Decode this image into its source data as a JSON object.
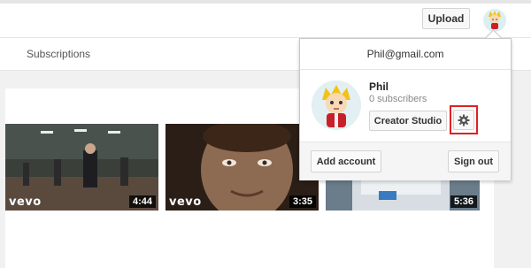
{
  "header": {
    "upload_label": "Upload"
  },
  "subnav": {
    "subscriptions_label": "Subscriptions"
  },
  "videos": [
    {
      "duration": "4:44",
      "badge": "vevo"
    },
    {
      "duration": "3:35",
      "badge": "vevo"
    },
    {
      "duration": "5:36",
      "badge": ""
    }
  ],
  "account_menu": {
    "email": "Phil@gmail.com",
    "name": "Phil",
    "subscribers": "0 subscribers",
    "creator_studio_label": "Creator Studio",
    "add_account_label": "Add account",
    "sign_out_label": "Sign out",
    "settings_icon": "gear-icon",
    "highlight_color": "#e02020"
  }
}
